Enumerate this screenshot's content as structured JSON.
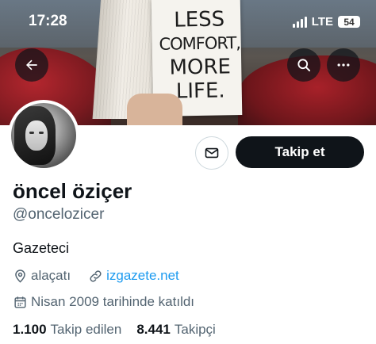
{
  "status_bar": {
    "time": "17:28",
    "network": "LTE",
    "battery": "54"
  },
  "banner": {
    "line1": "LESS",
    "line2": "COMFORT,",
    "line3": "MORE",
    "line4": "LIFE."
  },
  "icons": {
    "back": "arrow-left-icon",
    "search": "search-icon",
    "more": "more-horizontal-icon",
    "message": "envelope-icon",
    "location": "location-pin-icon",
    "link": "link-icon",
    "calendar": "calendar-icon"
  },
  "actions": {
    "follow_label": "Takip et"
  },
  "profile": {
    "display_name": "öncel öziçer",
    "handle": "@oncelozicer",
    "bio": "Gazeteci",
    "location": "alaçatı",
    "website": "izgazete.net",
    "joined": "Nisan 2009 tarihinde katıldı",
    "following_count": "1.100",
    "following_label": "Takip edilen",
    "followers_count": "8.441",
    "followers_label": "Takipçi"
  },
  "colors": {
    "text": "#0f1419",
    "secondary": "#536471",
    "link": "#1d9bf0",
    "button": "#0f1419"
  }
}
